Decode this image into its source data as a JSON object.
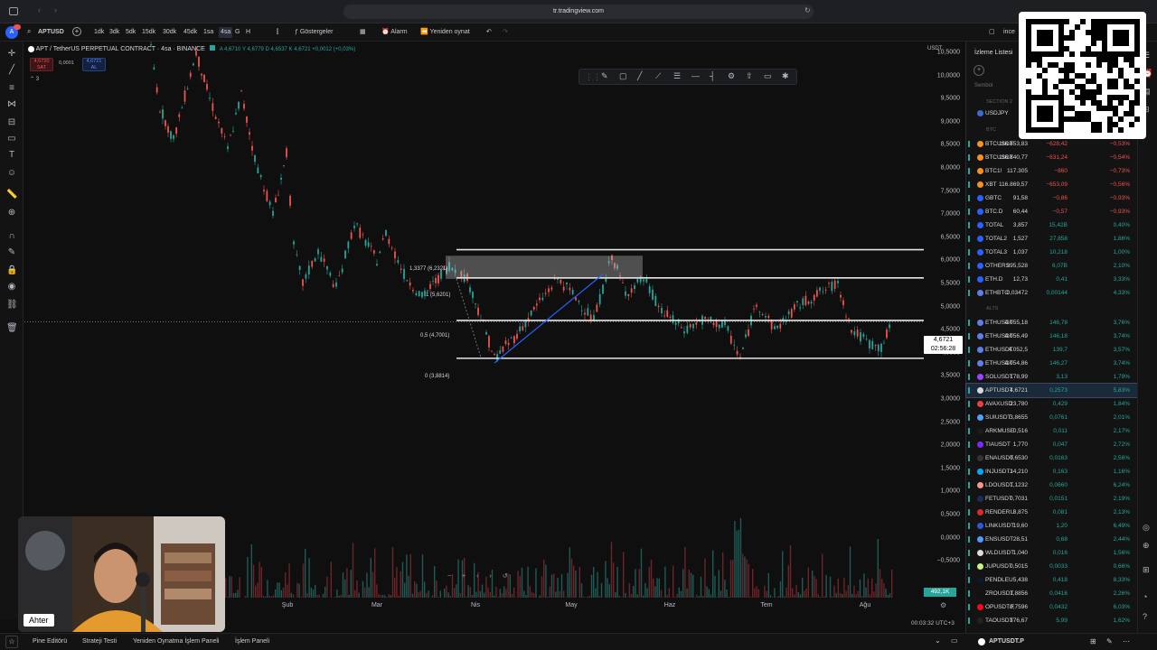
{
  "browser": {
    "url": "tr.tradingview.com"
  },
  "toolbar": {
    "symbol": "APTUSD",
    "intervals": [
      "1dk",
      "3dk",
      "5dk",
      "15dk",
      "30dk",
      "45dk",
      "1sa",
      "4sa",
      "G",
      "H"
    ],
    "active_interval": "4sa",
    "indicators_label": "Göstergeler",
    "alarm_label": "Alarm",
    "replay_label": "Yeniden oynat",
    "right_label": "ince"
  },
  "legend": {
    "title": "APT / TetherUS PERPETUAL CONTRACT · 4sa · BINANCE",
    "ohlc": "A 4,6710  Y 4,6779  D 4,6537  K 4,6721  +0,0012 (+0,03%)",
    "sell_price": "4,6720",
    "sell_label": "SAT",
    "spread": "0,0001",
    "buy_price": "4,6721",
    "buy_label": "AL",
    "indicator_count": "3"
  },
  "fib_labels": {
    "l1": "1,3377 (6,2321)",
    "l2": "1 (5,6201)",
    "l3": "0,5 (4,7001)",
    "l4": "0 (3,8814)"
  },
  "price_axis": {
    "currency": "USDT",
    "labels": [
      "10,5000",
      "10,0000",
      "9,5000",
      "9,0000",
      "8,5000",
      "8,0000",
      "7,5000",
      "7,0000",
      "6,5000",
      "6,0000",
      "5,5000",
      "5,0000",
      "4,5000",
      "4,0000",
      "3,5000",
      "3,0000",
      "2,5000",
      "2,0000",
      "1,5000",
      "1,0000",
      "0,5000",
      "0,0000",
      "−0,5000"
    ],
    "current_price": "4,6721",
    "countdown": "02:56:28",
    "volume_badge": "492,1K"
  },
  "time_axis": [
    "Şub",
    "Mar",
    "Nis",
    "May",
    "Haz",
    "Tem",
    "Ağu"
  ],
  "status": {
    "clock": "00:03:32 UTC+3"
  },
  "bottom_tabs": [
    "Pine Editörü",
    "Strateji Testi",
    "Yeniden Oynatma İşlem Paneli",
    "İşlem Paneli"
  ],
  "webcam_label": "Ahter",
  "watchlist": {
    "title": "İzleme Listesi",
    "column_symbol": "Sembol",
    "section_2": "SECTION 2",
    "usdjpy": "USDJPY",
    "section_btc": "BTC",
    "section_alts": "ALTS",
    "btc_rows": [
      {
        "sym": "BTCUSDT",
        "last": "116.853,83",
        "chg": "−628,42",
        "pct": "−0,53%",
        "color": "#f7931a",
        "dir": "neg"
      },
      {
        "sym": "BTCUSDT",
        "last": "116.840,77",
        "chg": "−631,24",
        "pct": "−0,54%",
        "color": "#f7931a",
        "dir": "neg"
      },
      {
        "sym": "BTC1!",
        "last": "117.305",
        "chg": "−860",
        "pct": "−0,73%",
        "color": "#f7931a",
        "dir": "neg"
      },
      {
        "sym": "XBT",
        "last": "116.869,57",
        "chg": "−653,09",
        "pct": "−0,56%",
        "color": "#f7931a",
        "dir": "neg"
      },
      {
        "sym": "GBTC",
        "last": "91,58",
        "chg": "−0,86",
        "pct": "−0,93%",
        "color": "#2962ff",
        "dir": "neg"
      },
      {
        "sym": "BTC.D",
        "last": "60,44",
        "chg": "−0,57",
        "pct": "−0,93%",
        "color": "#2962ff",
        "dir": "neg"
      },
      {
        "sym": "TOTAL",
        "last": "3,857",
        "chg": "15,42B",
        "pct": "0,40%",
        "color": "#2962ff",
        "dir": "pos"
      },
      {
        "sym": "TOTAL2",
        "last": "1,527",
        "chg": "27,858",
        "pct": "1,86%",
        "color": "#2962ff",
        "dir": "pos"
      },
      {
        "sym": "TOTAL3",
        "last": "1,037",
        "chg": "10,218",
        "pct": "1,00%",
        "color": "#2962ff",
        "dir": "pos"
      },
      {
        "sym": "OTHERS",
        "last": "295,528",
        "chg": "6,07B",
        "pct": "2,10%",
        "color": "#2962ff",
        "dir": "pos"
      },
      {
        "sym": "ETH.D",
        "last": "12,73",
        "chg": "0,41",
        "pct": "3,33%",
        "color": "#2962ff",
        "dir": "pos"
      },
      {
        "sym": "ETHBTC",
        "last": "0,03472",
        "chg": "0,00144",
        "pct": "4,33%",
        "color": "#627eea",
        "dir": "pos"
      }
    ],
    "alt_rows": [
      {
        "sym": "ETHUSDT",
        "last": "4.055,18",
        "chg": "146,78",
        "pct": "3,76%",
        "color": "#627eea",
        "dir": "pos"
      },
      {
        "sym": "ETHUSDT",
        "last": "4.056,49",
        "chg": "146,18",
        "pct": "3,74%",
        "color": "#627eea",
        "dir": "pos"
      },
      {
        "sym": "ETHUSDT",
        "last": "4.052,5",
        "chg": "139,7",
        "pct": "3,57%",
        "color": "#627eea",
        "dir": "pos"
      },
      {
        "sym": "ETHUSDT",
        "last": "4.054,86",
        "chg": "146,27",
        "pct": "3,74%",
        "color": "#627eea",
        "dir": "pos"
      },
      {
        "sym": "SOLUSDT",
        "last": "178,99",
        "chg": "3,13",
        "pct": "1,79%",
        "color": "#9945ff",
        "dir": "pos"
      },
      {
        "sym": "APTUSDT",
        "last": "4,6721",
        "chg": "0,2573",
        "pct": "5,83%",
        "color": "#d5d8de",
        "dir": "pos",
        "selected": true
      },
      {
        "sym": "AVAXUSD",
        "last": "23,780",
        "chg": "0,429",
        "pct": "1,84%",
        "color": "#e84142",
        "dir": "pos"
      },
      {
        "sym": "SUIUSDT",
        "last": "3,8655",
        "chg": "0,0761",
        "pct": "2,01%",
        "color": "#4da2ff",
        "dir": "pos"
      },
      {
        "sym": "ARKMUSE",
        "last": "0,516",
        "chg": "0,011",
        "pct": "2,17%",
        "color": "#1c1c1c",
        "dir": "pos"
      },
      {
        "sym": "TIAUSDT",
        "last": "1,770",
        "chg": "0,047",
        "pct": "2,72%",
        "color": "#7b2bf9",
        "dir": "pos"
      },
      {
        "sym": "ENAUSDT",
        "last": "0,6530",
        "chg": "0,0163",
        "pct": "2,56%",
        "color": "#333333",
        "dir": "pos"
      },
      {
        "sym": "INJUSDT.I",
        "last": "14,210",
        "chg": "0,163",
        "pct": "1,16%",
        "color": "#00aaff",
        "dir": "pos"
      },
      {
        "sym": "LDOUSDT",
        "last": "1,1232",
        "chg": "0,0660",
        "pct": "6,24%",
        "color": "#f69988",
        "dir": "pos"
      },
      {
        "sym": "FETUSDT",
        "last": "0,7031",
        "chg": "0,0151",
        "pct": "2,19%",
        "color": "#1d2b5a",
        "dir": "pos"
      },
      {
        "sym": "RENDERU",
        "last": "3,875",
        "chg": "0,081",
        "pct": "2,13%",
        "color": "#d92b2b",
        "dir": "pos"
      },
      {
        "sym": "LINKUSDT",
        "last": "19,60",
        "chg": "1,20",
        "pct": "6,49%",
        "color": "#2a5ada",
        "dir": "pos"
      },
      {
        "sym": "ENSUSDT",
        "last": "28,51",
        "chg": "0,68",
        "pct": "2,44%",
        "color": "#5298ff",
        "dir": "pos"
      },
      {
        "sym": "WLDUSDT",
        "last": "1,040",
        "chg": "0,016",
        "pct": "1,56%",
        "color": "#dddddd",
        "dir": "pos"
      },
      {
        "sym": "JUPUSDT",
        "last": "0,5015",
        "chg": "0,0033",
        "pct": "0,66%",
        "color": "#c7f284",
        "dir": "pos"
      },
      {
        "sym": "PENDLEU",
        "last": "5,438",
        "chg": "0,418",
        "pct": "8,33%",
        "color": "#0e1a2b",
        "dir": "pos"
      },
      {
        "sym": "ZROUSDT",
        "last": "1,8856",
        "chg": "0,0416",
        "pct": "2,26%",
        "color": "#111111",
        "dir": "pos"
      },
      {
        "sym": "OPUSDT.F",
        "last": "0,7596",
        "chg": "0,0432",
        "pct": "6,03%",
        "color": "#ff0420",
        "dir": "pos"
      },
      {
        "sym": "TAOUSDT",
        "last": "376,67",
        "chg": "5,99",
        "pct": "1,62%",
        "color": "#222222",
        "dir": "pos"
      }
    ],
    "bottom_symbol": "APTUSDT.P"
  }
}
